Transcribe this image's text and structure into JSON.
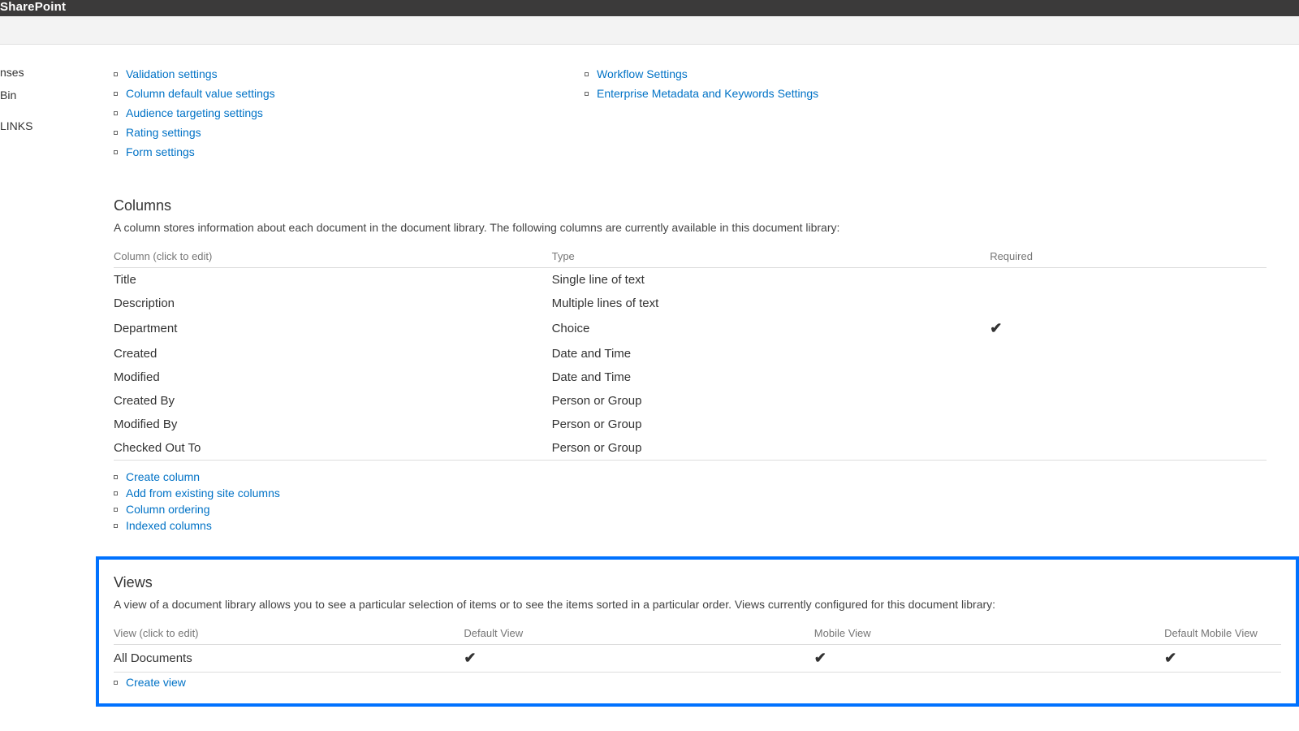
{
  "header": {
    "brand": "SharePoint"
  },
  "leftnav": {
    "items": [
      "nses",
      "Bin"
    ],
    "editlinks": "LINKS"
  },
  "settings_links": {
    "col1": [
      "Validation settings",
      "Column default value settings",
      "Audience targeting settings",
      "Rating settings",
      "Form settings"
    ],
    "col2": [
      "Workflow Settings",
      "Enterprise Metadata and Keywords Settings"
    ]
  },
  "columns_section": {
    "title": "Columns",
    "desc": "A column stores information about each document in the document library. The following columns are currently available in this document library:",
    "headers": {
      "name": "Column (click to edit)",
      "type": "Type",
      "required": "Required"
    },
    "rows": [
      {
        "name": "Title",
        "type": "Single line of text",
        "required": false
      },
      {
        "name": "Description",
        "type": "Multiple lines of text",
        "required": false
      },
      {
        "name": "Department",
        "type": "Choice",
        "required": true
      },
      {
        "name": "Created",
        "type": "Date and Time",
        "required": false
      },
      {
        "name": "Modified",
        "type": "Date and Time",
        "required": false
      },
      {
        "name": "Created By",
        "type": "Person or Group",
        "required": false
      },
      {
        "name": "Modified By",
        "type": "Person or Group",
        "required": false
      },
      {
        "name": "Checked Out To",
        "type": "Person or Group",
        "required": false
      }
    ],
    "actions": [
      "Create column",
      "Add from existing site columns",
      "Column ordering",
      "Indexed columns"
    ]
  },
  "views_section": {
    "title": "Views",
    "desc": "A view of a document library allows you to see a particular selection of items or to see the items sorted in a particular order. Views currently configured for this document library:",
    "headers": {
      "view": "View (click to edit)",
      "default": "Default View",
      "mobile": "Mobile View",
      "defmobile": "Default Mobile View"
    },
    "rows": [
      {
        "name": "All Documents",
        "default": true,
        "mobile": true,
        "defmobile": true
      }
    ],
    "actions": [
      "Create view"
    ]
  }
}
